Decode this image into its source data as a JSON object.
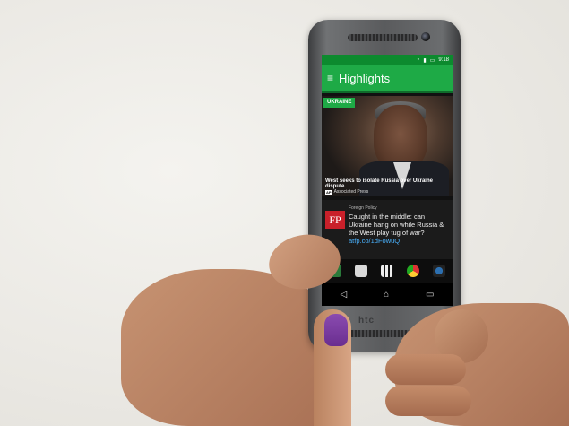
{
  "status_bar": {
    "time": "9:18"
  },
  "app_bar": {
    "menu_glyph": "≡",
    "title": "Highlights"
  },
  "story_1": {
    "tag": "UKRAINE",
    "headline": "West seeks to isolate Russia over Ukraine dispute",
    "source_badge": "AP",
    "source": "Associated Press"
  },
  "story_2": {
    "logo": "FP",
    "source": "Foreign Policy",
    "text": "Caught in the middle: can Ukraine hang on while Russia & the West play tug of war?",
    "link": "atfp.co/1dFowuQ"
  },
  "dock_icons": [
    "phone-icon",
    "messages-icon",
    "apps-icon",
    "chrome-icon",
    "camera-icon"
  ],
  "nav_icons": [
    "back-icon",
    "home-icon",
    "recents-icon"
  ],
  "brand": "htc",
  "colors": {
    "accent_green": "#1eaa46",
    "nail_polish": "#7a3aa0",
    "fp_red": "#c9202a"
  }
}
